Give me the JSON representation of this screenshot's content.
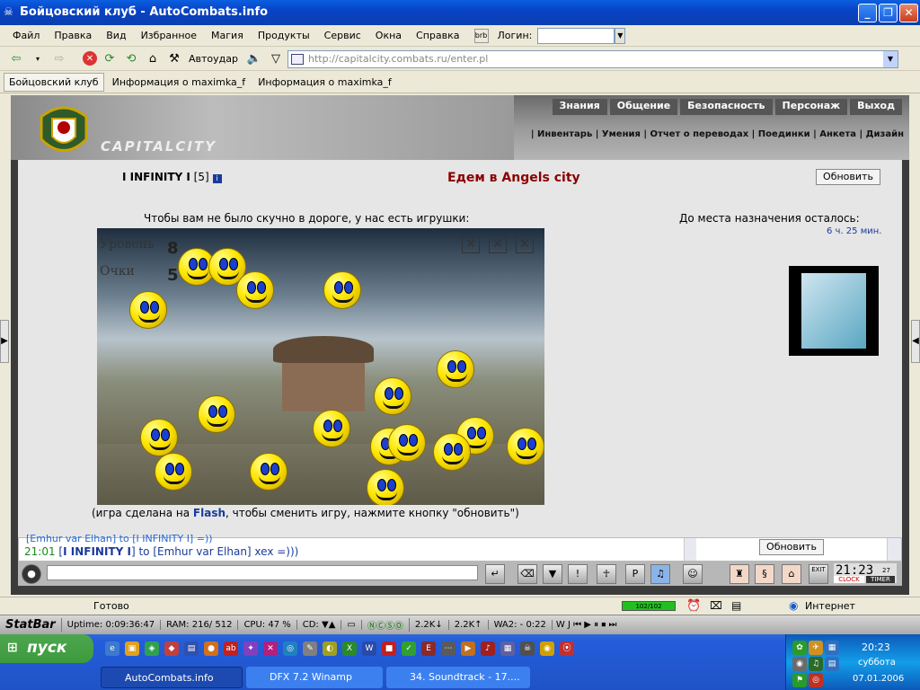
{
  "window": {
    "title": "Бойцовский клуб - AutoCombats.info"
  },
  "menu": {
    "items": [
      "Файл",
      "Правка",
      "Вид",
      "Избранное",
      "Магия",
      "Продукты",
      "Сервис",
      "Окна",
      "Справка"
    ],
    "login_label": "Логин:"
  },
  "toolbar": {
    "autoudar_label": "Автоудар",
    "address": "http://capitalcity.combats.ru/enter.pl"
  },
  "links": [
    "Бойцовский клуб",
    "Информация о maximka_f",
    "Информация о maximka_f"
  ],
  "site": {
    "nav_main": [
      "Знания",
      "Общение",
      "Безопасность",
      "Персонаж",
      "Выход"
    ],
    "nav_sub": "| Инвентарь | Умения | Отчет о переводах | Поединки | Анкета | Дизайн",
    "city_logo": "CAPITALCITY"
  },
  "content": {
    "player": "I INFINITY I",
    "player_level": "[5]",
    "heading": "Едем в Angels city",
    "refresh_label": "Обновить",
    "game_intro": "Чтобы вам не было скучно в дороге, у нас есть игрушки:",
    "remaining_label": "До места назначения осталось:",
    "remaining_time": "6 ч. 25 мин.",
    "game_level_label": "Уровень",
    "game_level": "8",
    "game_score_label": "Очки",
    "game_score": "5",
    "footnote_pre": "(игра сделана на ",
    "footnote_flash": "Flash",
    "footnote_post": ", чтобы сменить игру, нажмите кнопку \"обновить\")"
  },
  "chat": {
    "partial_line": "[Emhur var Elhan] to [I INFINITY I] =)) ",
    "time": "21:01",
    "from": "I INFINITY I",
    "to_text": "to [Emhur var Elhan] xex =)))",
    "refresh_label": "Обновить",
    "clock": "21:23",
    "clock_sec": "27",
    "clock_label": "CLOCK",
    "timer_label": "TIMER",
    "exit_label": "EXIT"
  },
  "status": {
    "text": "Готово",
    "progress": "102/102",
    "zone": "Интернет"
  },
  "statbar": {
    "brand": "StatBar",
    "uptime_label": "Uptime:",
    "uptime": "0:09:36:47",
    "ram_label": "RAM:",
    "ram": "216/ 512",
    "cpu_label": "CPU:",
    "cpu": "47 %",
    "cd_label": "CD:",
    "down": "2.2K",
    "up": "2.2K",
    "wa2": "WA2: - 0:22"
  },
  "taskbar": {
    "start_label": "пуск",
    "tasks": [
      "AutoCombats.info",
      "DFX 7.2 Winamp",
      "34. Soundtrack - 17...."
    ],
    "clock_time": "20:23",
    "clock_day": "суббота",
    "clock_date": "07.01.2006"
  },
  "colors": {
    "heading": "#8b0000",
    "link_blue": "#1a3a9a",
    "chat_green": "#1a8a1a"
  }
}
